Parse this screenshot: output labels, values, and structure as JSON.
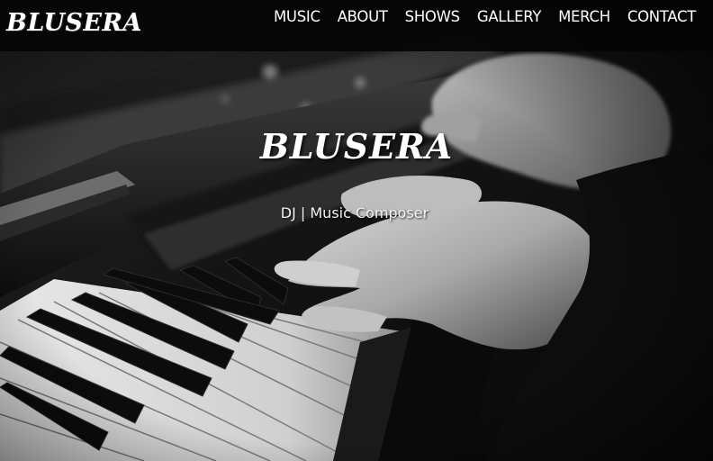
{
  "header": {
    "brand": "BLUSERA",
    "nav": [
      "MUSIC",
      "ABOUT",
      "SHOWS",
      "GALLERY",
      "MERCH",
      "CONTACT"
    ]
  },
  "hero": {
    "title": "BLUSERA",
    "subtitle": "DJ | Music Composer",
    "image_icon": "piano-hands-photo"
  },
  "colors": {
    "navbar_bg": "#050505",
    "text": "#ffffff"
  }
}
